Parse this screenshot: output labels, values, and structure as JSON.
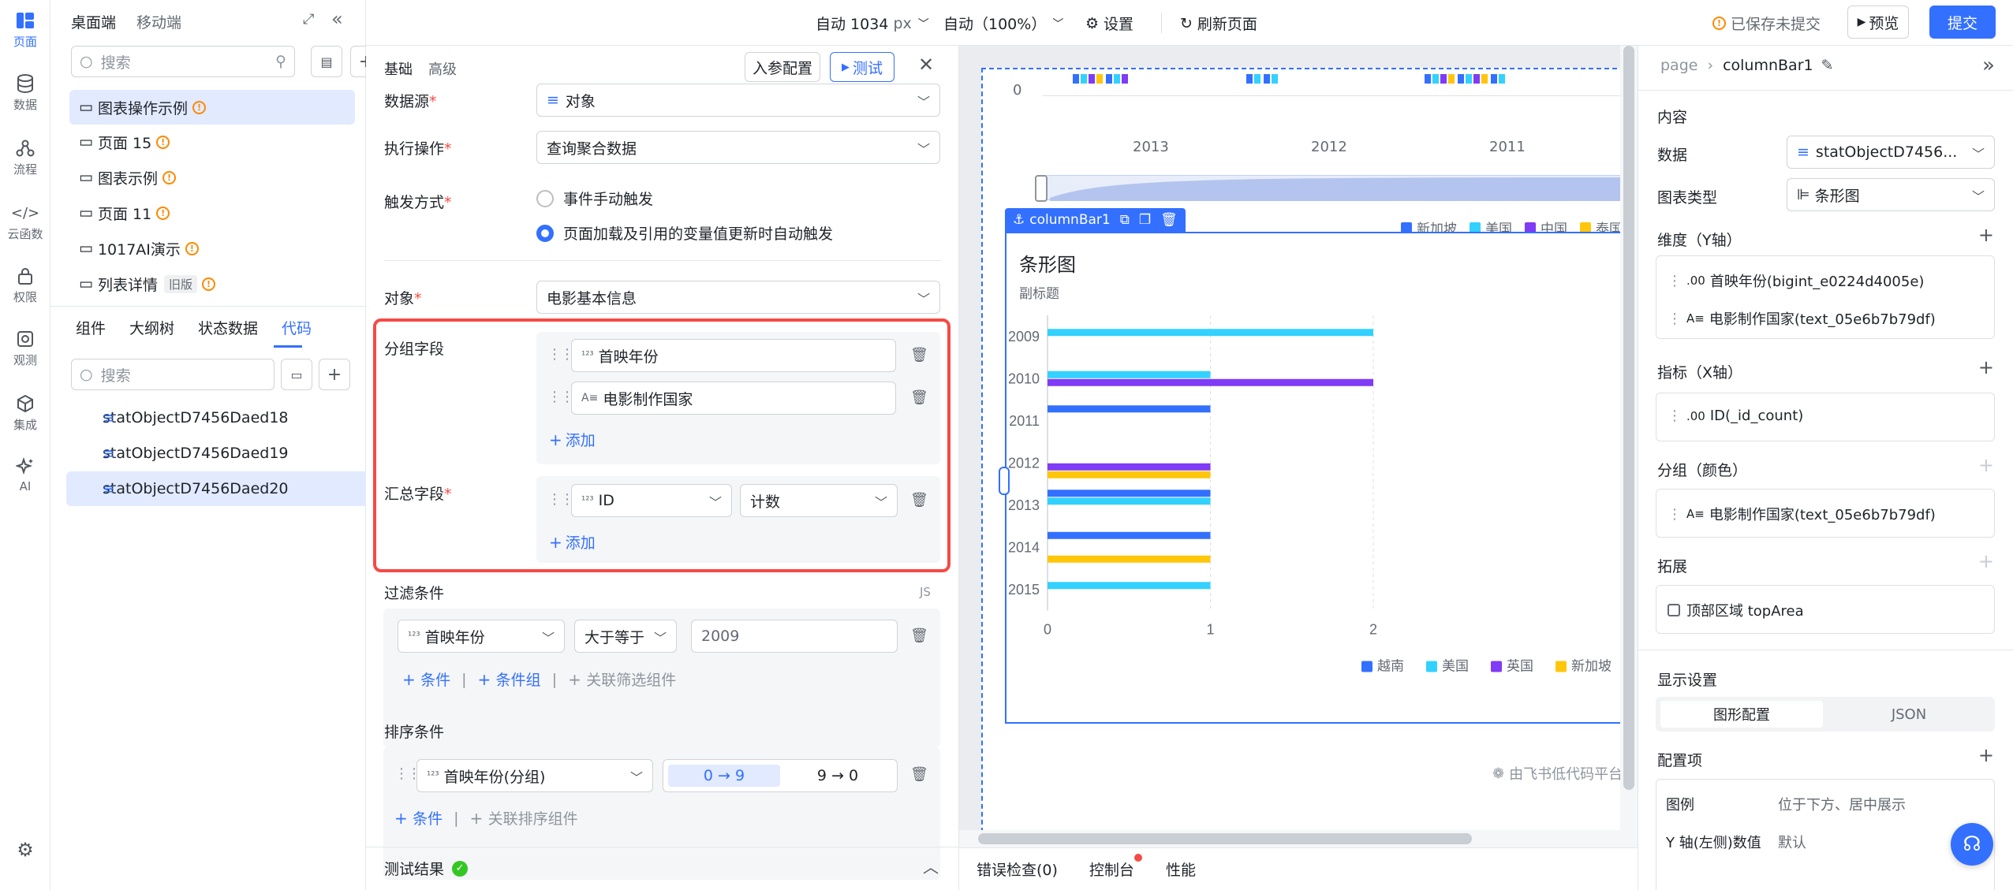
{
  "rail": {
    "items": [
      {
        "label": "页面",
        "icon": "page-icon"
      },
      {
        "label": "数据",
        "icon": "database-icon"
      },
      {
        "label": "流程",
        "icon": "flow-icon"
      },
      {
        "label": "云函数",
        "icon": "code-icon"
      },
      {
        "label": "权限",
        "icon": "lock-icon"
      },
      {
        "label": "观测",
        "icon": "observe-icon"
      },
      {
        "label": "集成",
        "icon": "integration-icon"
      },
      {
        "label": "AI",
        "icon": "ai-icon"
      }
    ]
  },
  "left": {
    "tabs_top": [
      "桌面端",
      "移动端"
    ],
    "search_placeholder": "搜索",
    "pages": [
      {
        "label": "图表操作示例",
        "warn": true
      },
      {
        "label": "页面 15",
        "warn": true
      },
      {
        "label": "图表示例",
        "warn": true
      },
      {
        "label": "页面 11",
        "warn": true
      },
      {
        "label": "1017AI演示",
        "warn": true
      },
      {
        "label": "列表详情",
        "badge": "旧版",
        "warn": true
      }
    ],
    "tabs": [
      "组件",
      "大纲树",
      "状态数据",
      "代码"
    ],
    "code_search_placeholder": "搜索",
    "code_items": [
      "statObjectD7456Daed18",
      "statObjectD7456Daed19",
      "statObjectD7456Daed20"
    ]
  },
  "topbar": {
    "width": "自动 1034",
    "width_unit": "px",
    "zoom": "自动（100%）",
    "settings": "设置",
    "refresh": "刷新页面",
    "saved": "已保存未提交",
    "preview": "预览",
    "submit": "提交"
  },
  "config": {
    "tabs": [
      "基础",
      "高级"
    ],
    "param_btn": "入参配置",
    "test_btn": "测试",
    "datasource_label": "数据源",
    "datasource_value": "对象",
    "action_label": "执行操作",
    "action_value": "查询聚合数据",
    "trigger_label": "触发方式",
    "trigger_opt1": "事件手动触发",
    "trigger_opt2": "页面加载及引用的变量值更新时自动触发",
    "object_label": "对象",
    "object_value": "电影基本信息",
    "group_label": "分组字段",
    "group_fields": [
      {
        "type": "¹²³",
        "name": "首映年份"
      },
      {
        "type": "A≡",
        "name": "电影制作国家"
      }
    ],
    "add": "添加",
    "agg_label": "汇总字段",
    "agg_field_type": "¹²³",
    "agg_field": "ID",
    "agg_func": "计数",
    "filter_label": "过滤条件",
    "filter_js": "JS",
    "filter_field": "首映年份",
    "filter_op": "大于等于",
    "filter_value": "2009",
    "cond": "条件",
    "cond_group": "条件组",
    "link_filter": "关联筛选组件",
    "sort_label": "排序条件",
    "sort_field": "首映年份(分组)",
    "sort_asc": "0 → 9",
    "sort_desc": "9 → 0",
    "link_sort": "关联排序组件",
    "result_label": "测试结果"
  },
  "canvas": {
    "top_years": [
      "2013",
      "2012",
      "2011"
    ],
    "top_zero": "0",
    "top_legend": [
      {
        "name": "新加坡",
        "color": "#3370ff"
      },
      {
        "name": "美国",
        "color": "#33d1ff"
      },
      {
        "name": "中国",
        "color": "#7f3bf5"
      },
      {
        "name": "泰国",
        "color": "#ffc60a"
      }
    ],
    "comp_name": "columnBar1",
    "watermark": "由飞书低代码平台",
    "errors": "错误检查(0)",
    "console": "控制台",
    "perf": "性能"
  },
  "chart_data": {
    "type": "bar",
    "orientation": "horizontal",
    "title": "条形图",
    "subtitle": "副标题",
    "categories": [
      "2009",
      "2010",
      "2011",
      "2012",
      "2013",
      "2014",
      "2015"
    ],
    "xlim": [
      0,
      2
    ],
    "x_ticks": [
      "0",
      "1",
      "2"
    ],
    "series": [
      {
        "name": "越南",
        "color": "#3370ff",
        "values": [
          0,
          0,
          1,
          0,
          1,
          1,
          0
        ]
      },
      {
        "name": "美国",
        "color": "#33d1ff",
        "values": [
          2,
          1,
          0,
          0,
          1,
          0,
          1
        ]
      },
      {
        "name": "英国",
        "color": "#7f3bf5",
        "values": [
          0,
          2,
          0,
          1,
          0,
          0,
          0
        ]
      },
      {
        "name": "新加坡",
        "color": "#ffc60a",
        "values": [
          0,
          0,
          0,
          1,
          0,
          1,
          0
        ]
      }
    ],
    "legend": "bottom-right"
  },
  "right": {
    "breadcrumb_root": "page",
    "breadcrumb_current": "columnBar1",
    "section": "内容",
    "data_label": "数据",
    "data_value": "statObjectD7456...",
    "chart_type_label": "图表类型",
    "chart_type_value": "条形图",
    "dim_label": "维度（Y轴）",
    "dims": [
      {
        "type": ".00",
        "name": "首映年份(bigint_e0224d4005e)"
      },
      {
        "type": "A≡",
        "name": "电影制作国家(text_05e6b7b79df)"
      }
    ],
    "metric_label": "指标（X轴）",
    "metric": {
      "type": ".00",
      "name": "ID(_id_count)"
    },
    "group_label": "分组（颜色）",
    "group": {
      "type": "A≡",
      "name": "电影制作国家(text_05e6b7b79df)"
    },
    "ext_label": "拓展",
    "ext_item": "顶部区域 topArea",
    "display_label": "显示设置",
    "display_tabs": [
      "图形配置",
      "JSON"
    ],
    "config_label": "配置项",
    "legend_key": "图例",
    "legend_value": "位于下方、居中展示",
    "yaxis_key": "Y 轴(左侧)数值",
    "yaxis_value": "默认"
  }
}
